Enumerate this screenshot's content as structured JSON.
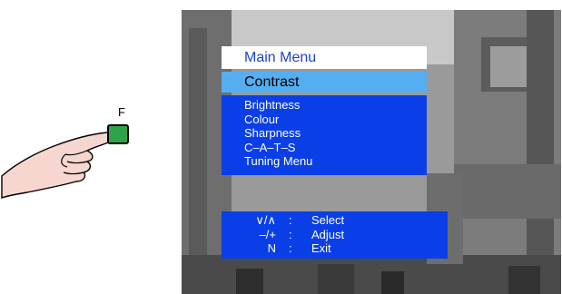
{
  "keypad": {
    "key_label": "F",
    "key_color": "#2fa34a"
  },
  "osd": {
    "title": "Main Menu",
    "selected_item": "Contrast",
    "items": [
      "Brightness",
      "Colour",
      "Sharpness",
      "C–A–T–S",
      "Tuning Menu"
    ],
    "help": [
      {
        "key": "∨/∧",
        "colon": ":",
        "action": "Select"
      },
      {
        "key": "–/+",
        "colon": ":",
        "action": "Adjust"
      },
      {
        "key": "N",
        "colon": ":",
        "action": "Exit"
      }
    ],
    "colors": {
      "title_bg": "#ffffff",
      "title_text": "#1a44c8",
      "selected_bg": "#55aef0",
      "menu_bg": "#0a3fe8"
    }
  }
}
